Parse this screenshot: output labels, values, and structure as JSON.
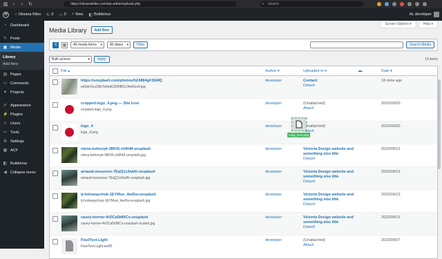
{
  "browser": {
    "url": "https://oksanakiiko.com/wp-admin/upload.php",
    "search_placeholder": "Search"
  },
  "admin_bar": {
    "site_name": "Oksana Kiiko",
    "updates_count": "3",
    "comments_count": "0",
    "new_label": "New",
    "builder_label": "Builderius",
    "greeting": "Hi, developer"
  },
  "sidebar": {
    "items": [
      {
        "label": "Dashboard",
        "icon": "dashboard-icon"
      },
      {
        "label": "Posts",
        "icon": "pin-icon"
      },
      {
        "label": "Media",
        "icon": "media-icon"
      },
      {
        "label": "Pages",
        "icon": "pages-icon"
      },
      {
        "label": "Comments",
        "icon": "comment-icon"
      },
      {
        "label": "Projects",
        "icon": "projects-icon"
      },
      {
        "label": "Appearance",
        "icon": "brush-icon"
      },
      {
        "label": "Plugins",
        "icon": "plugin-icon"
      },
      {
        "label": "Users",
        "icon": "users-icon"
      },
      {
        "label": "Tools",
        "icon": "wrench-icon"
      },
      {
        "label": "Settings",
        "icon": "settings-icon"
      },
      {
        "label": "ACF",
        "icon": "acf-icon"
      },
      {
        "label": "Builderius",
        "icon": "builder-icon"
      },
      {
        "label": "Collapse menu",
        "icon": "collapse-icon"
      }
    ],
    "media_sub": [
      "Library",
      "Add New"
    ]
  },
  "header": {
    "screen_options": "Screen Options ▾",
    "help": "Help ▾",
    "title": "Media Library",
    "add_new": "Add New"
  },
  "filters": {
    "type_select": "All media items",
    "date_select": "All dates",
    "filter_btn": "Filter",
    "search_btn": "Search Media"
  },
  "tablenav": {
    "bulk": "Bulk actions",
    "apply": "Apply",
    "count": "13 items"
  },
  "table": {
    "headers": {
      "file": "File ▴",
      "author": "Author ▾",
      "uploaded": "Uploaded to ▾",
      "date": "Date ▾"
    },
    "rows": [
      {
        "title": "https://unsplash.com/photos/hZ4884gF2EMQ",
        "file": "ee0dc41a29b7b9ed6326f80124e66cef.jpg",
        "author": "developer",
        "uploaded": "Contact",
        "action": "Detach",
        "date": "18 mins ago"
      },
      {
        "title": "cropped-logo_4.png — Site Icon",
        "file": "cropped-logo_4.png",
        "author": "developer",
        "uploaded": "(Unattached)",
        "action": "Attach",
        "date": "2023/09/20"
      },
      {
        "title": "logo_4",
        "file": "logo_4.png",
        "author": "developer",
        "uploaded": "(Unattached)",
        "action": "Attach",
        "date": "2023/09/20"
      },
      {
        "title": "olena-bohovyk-3BIVILvh9hM-unsplash",
        "file": "olena-bohovyk-3BIVILvh9hM-unsplash.jpg",
        "author": "developer",
        "uploaded": "Victoria Design website and something else title",
        "action": "Detach",
        "date": "2023/09/13"
      },
      {
        "title": "arnaud-mesureur-7EqQ1s3wIAI-unsplash",
        "file": "arnaud-mesureur-7EqQ1s3wIAI-unsplash.jpg",
        "author": "developer",
        "uploaded": "Victoria Design website and something else title",
        "action": "Detach",
        "date": "2023/09/13"
      },
      {
        "title": "tj-holowaychuk-1EYMue_AwDw-unsplash",
        "file": "tj-holowaychuk-1EYMue_AwDw-unsplash.jpg",
        "author": "developer",
        "uploaded": "Victoria Design website and something else title",
        "action": "Detach",
        "date": "2023/09/13"
      },
      {
        "title": "casey-horner-4rDCa5hBlCs-unsplash",
        "file": "casey-horner-4rDCa5hBlCs-unsplash-scaled.jpg",
        "author": "developer",
        "uploaded": "Victoria Design website and something else title",
        "action": "Detach",
        "date": "2023/09/13"
      },
      {
        "title": "FixelText-Light",
        "file": "FixelText-Light.woff2",
        "author": "developer",
        "uploaded": "(Unattached)",
        "action": "Attach",
        "date": "2023/09/07"
      }
    ]
  },
  "drag": {
    "label": "copy_icon.png"
  },
  "colors": {
    "accent": "#2271b1",
    "admin_dark": "#1d2327",
    "drag_green": "#4ab866"
  }
}
